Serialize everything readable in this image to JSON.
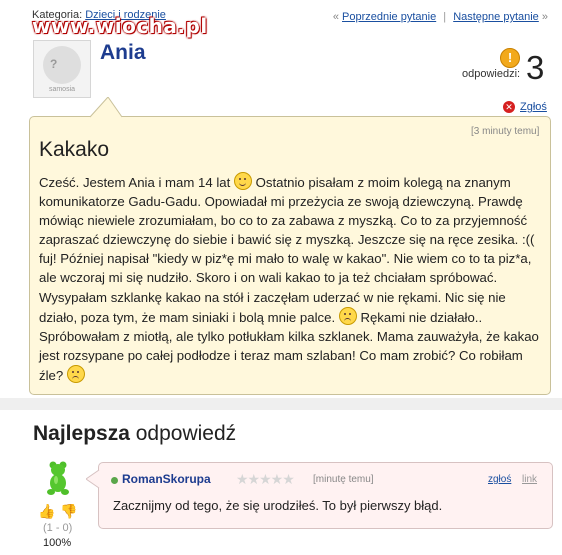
{
  "header": {
    "category_label": "Kategoria:",
    "category_link": "Dzieci i rodzenie",
    "watermark": "www.wiocha.pl",
    "nav_prev": "Poprzednie pytanie",
    "nav_next": "Następne pytanie",
    "nav_prev_arrow": "«",
    "nav_next_arrow": "»",
    "nav_sep": "|"
  },
  "avatar": {
    "caption": "samosia"
  },
  "question": {
    "author": "Ania",
    "answers_label": "odpowiedzi:",
    "answers_count": "3",
    "report_label": "Zgłoś",
    "time": "[3 minuty temu]",
    "title": "Kakako",
    "body_parts": [
      "Cześć. Jestem Ania i mam 14 lat ",
      " Ostatnio pisałam z moim kolegą na znanym komunikatorze Gadu-Gadu. Opowiadał mi przeżycia ze swoją dziewczyną. Prawdę mówiąc niewiele zrozumiałam, bo co to za zabawa z myszką. Co to za przyjemność zapraszać dziewczynę do siebie i bawić się z myszką. Jeszcze się na ręce zesika. :(( fuj! Później napisał \"kiedy w piz*ę mi mało to walę w kakao\". Nie wiem co to ta piz*a, ale wczoraj mi się nudziło. Skoro i on wali kakao to ja też chciałam spróbować. Wysypałam szklankę kakao na stół i zaczęłam uderzać w nie rękami. Nic się nie działo, poza tym, że mam siniaki i bolą mnie palce. ",
      " Rękami nie działało.. Spróbowałam z miotłą, ale tylko potłukłam kilka szklanek. Mama zauważyła, że kakao jest rozsypane po całej podłodze i teraz mam szlaban! Co mam zrobić? Co robiłam źle? ",
      ""
    ]
  },
  "best_answer": {
    "heading_bold": "Najlepsza",
    "heading_rest": " odpowiedź",
    "author": "RomanSkorupa",
    "stars": "★★★★★",
    "time": "[minutę temu]",
    "report_label": "zgłoś",
    "link_label": "link",
    "text": "Zacznijmy od tego, że się urodziłeś. To był pierwszy błąd.",
    "votes": "(1 - 0)",
    "percent": "100%"
  },
  "colors": {
    "accent": "#1d3c8f",
    "link": "#1a4fa0",
    "question_bg": "#fff8dc",
    "answer_bg": "#fff2f2",
    "answers_badge": "#f2a91c",
    "report_badge": "#d62020"
  }
}
